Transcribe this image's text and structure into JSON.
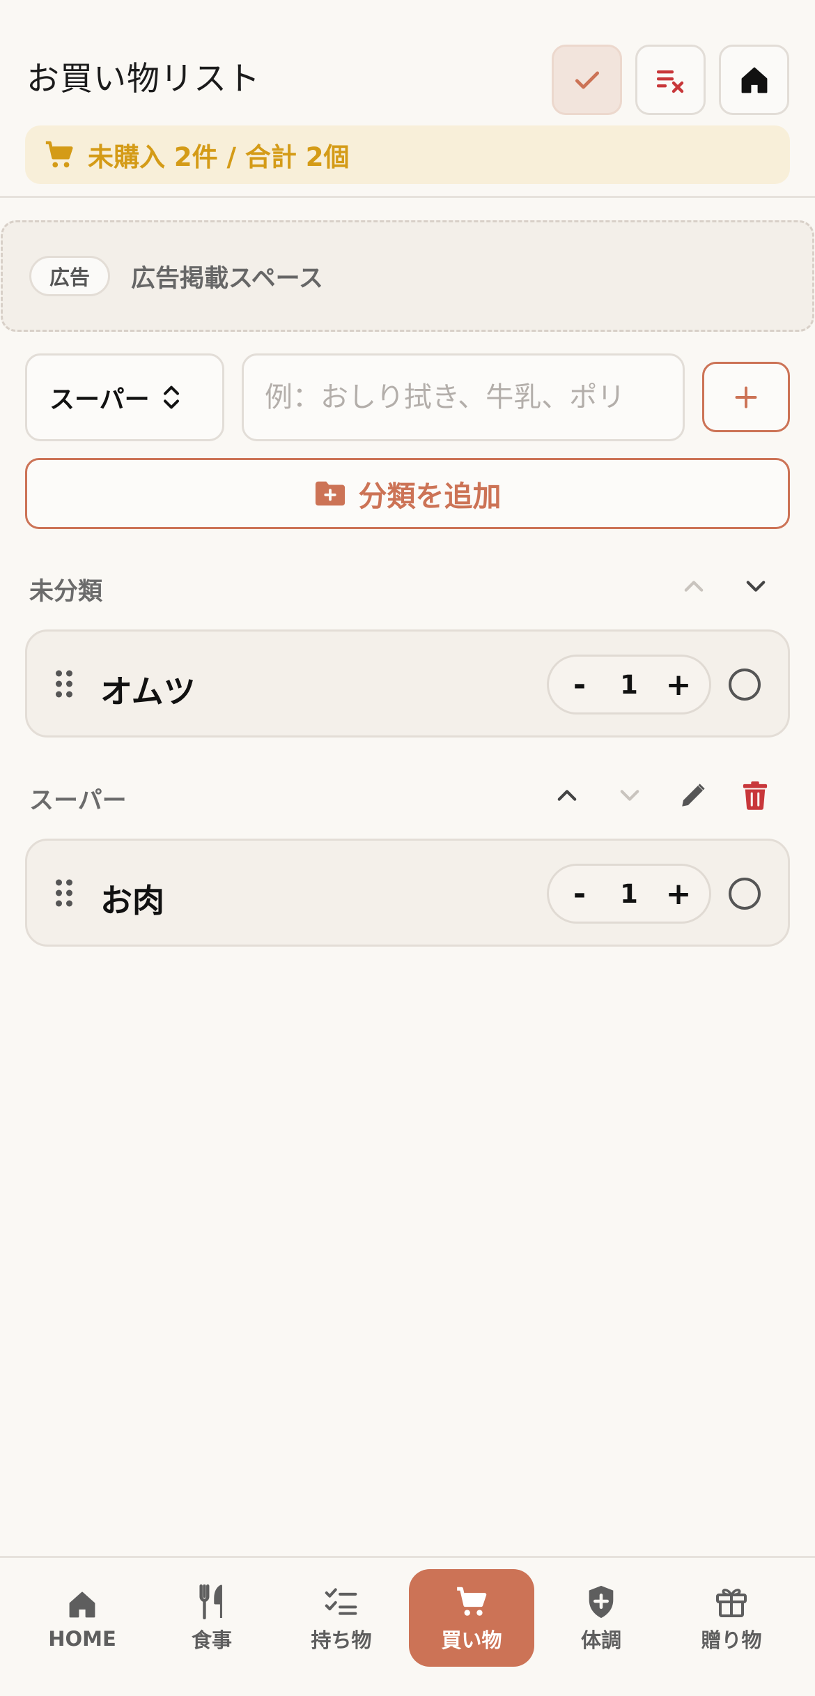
{
  "header": {
    "title": "お買い物リスト",
    "buttons": {
      "check": "check-icon",
      "clear": "clear-list-icon",
      "home": "home-icon"
    }
  },
  "summary": {
    "icon": "cart-icon",
    "text": "未購入 2件 / 合計 2個",
    "color": "#d49b17"
  },
  "ad": {
    "badge": "広告",
    "text": "広告掲載スペース"
  },
  "add_form": {
    "store_value": "スーパー",
    "item_placeholder": "例：おしり拭き、牛乳、ポリ",
    "add_icon": "plus-icon",
    "category_button": "分類を追加"
  },
  "sections": [
    {
      "title": "未分類",
      "items": [
        {
          "name": "オムツ",
          "qty": "1",
          "minus": "-",
          "plus": "+"
        }
      ]
    },
    {
      "title": "スーパー",
      "items": [
        {
          "name": "お肉",
          "qty": "1",
          "minus": "-",
          "plus": "+"
        }
      ]
    }
  ],
  "nav": {
    "tabs": [
      {
        "label": "HOME",
        "icon": "home-icon"
      },
      {
        "label": "食事",
        "icon": "fork-knife-icon"
      },
      {
        "label": "持ち物",
        "icon": "checklist-icon"
      },
      {
        "label": "買い物",
        "icon": "cart-icon",
        "active": true
      },
      {
        "label": "体調",
        "icon": "shield-plus-icon"
      },
      {
        "label": "贈り物",
        "icon": "gift-icon"
      }
    ]
  },
  "colors": {
    "accent": "#cc7356",
    "danger": "#c8373a",
    "summary_bg": "#f8efd9",
    "background": "#faf8f4"
  }
}
